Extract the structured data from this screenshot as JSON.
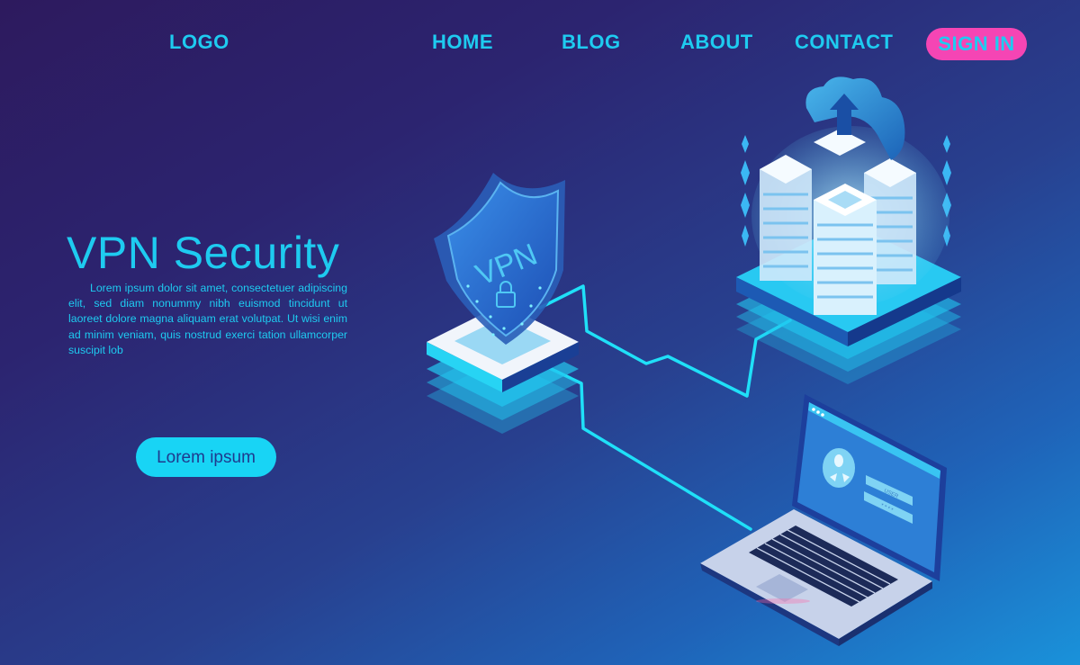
{
  "nav": {
    "logo": "LOGO",
    "links": [
      "HOME",
      "BLOG",
      "ABOUT",
      "CONTACT"
    ],
    "signin": "SIGN IN"
  },
  "hero": {
    "title": "VPN Security",
    "body": "Lorem ipsum dolor sit amet, consectetuer adipiscing elit, sed diam nonummy nibh euismod tincidunt ut laoreet dolore magna aliquam erat volutpat. Ut wisi enim ad minim veniam, quis nostrud exerci tation ullamcorper suscipit lob",
    "cta_label": "Lorem ipsum"
  },
  "illustration": {
    "shield_label": "VPN",
    "laptop_login": {
      "user_field": "USER",
      "password_field": "* * * *"
    }
  },
  "colors": {
    "accent": "#1ecbf0",
    "signin_bg": "#f545b4",
    "cta_bg": "#18d4f5",
    "bg_top_left": "#2d1a5e",
    "bg_bottom_right": "#1a92da"
  }
}
